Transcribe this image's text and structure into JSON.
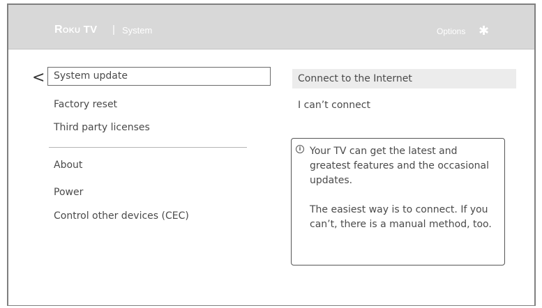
{
  "header": {
    "brand_roku": "Roku",
    "brand_tv": "TV",
    "separator": "|",
    "section": "System",
    "options_label": "Options",
    "options_icon": "✱"
  },
  "nav": {
    "back_glyph": "<"
  },
  "menu": {
    "items": [
      {
        "label": "System update",
        "selected": true
      },
      {
        "label": "Factory reset"
      },
      {
        "label": "Third party licenses"
      },
      {
        "label": "About"
      },
      {
        "label": "Power"
      },
      {
        "label": "Control other devices (CEC)"
      }
    ]
  },
  "submenu": {
    "items": [
      {
        "label": "Connect to the Internet",
        "highlighted": true
      },
      {
        "label": "I can’t connect"
      }
    ]
  },
  "info": {
    "icon": "i",
    "paragraph1": "Your TV can get the latest and greatest features and the occasional updates.",
    "paragraph2": "The easiest way is to connect. If you can’t, there is a manual method, too."
  },
  "colors": {
    "header_bg": "#d8d8d8",
    "header_text": "#ffffff",
    "text": "#4a4a4a",
    "highlight": "#ececec",
    "frame": "#7f7f7f"
  }
}
